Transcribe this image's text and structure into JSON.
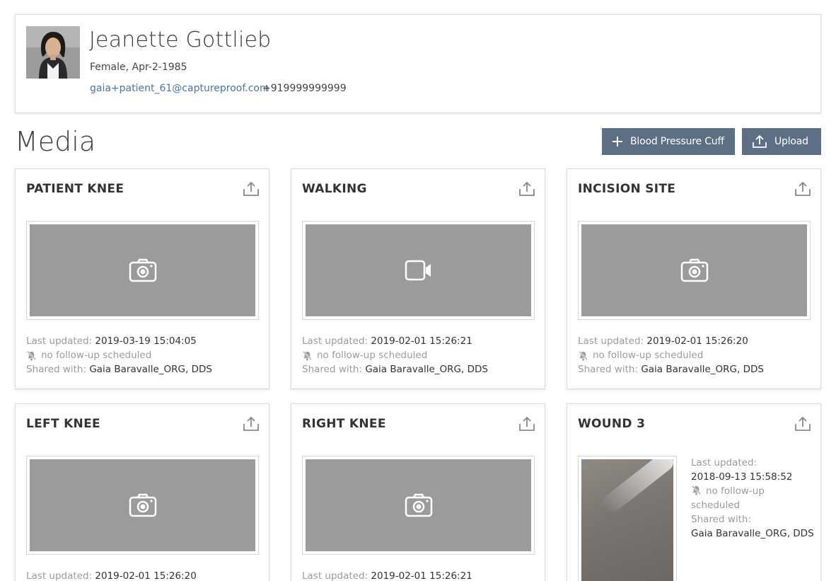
{
  "patient": {
    "name": "Jeanette Gottlieb",
    "demographics": "Female, Apr-2-1985",
    "email": "gaia+patient_61@captureproof.com",
    "phone": "+919999999999"
  },
  "media": {
    "title": "Media",
    "buttons": {
      "blood_pressure": "Blood Pressure Cuff",
      "upload": "Upload"
    },
    "labels": {
      "last_updated": "Last updated:",
      "no_followup": "no follow-up scheduled",
      "no_followup_line1": "no follow-up",
      "no_followup_line2": "scheduled",
      "shared_with": "Shared with:"
    },
    "cards": [
      {
        "title": "PATIENT KNEE",
        "type": "photo-placeholder",
        "last_updated": "2019-03-19 15:04:05",
        "shared_with": "Gaia Baravalle_ORG, DDS"
      },
      {
        "title": "WALKING",
        "type": "video-placeholder",
        "last_updated": "2019-02-01 15:26:21",
        "shared_with": "Gaia Baravalle_ORG, DDS"
      },
      {
        "title": "INCISION SITE",
        "type": "photo-placeholder",
        "last_updated": "2019-02-01 15:26:20",
        "shared_with": "Gaia Baravalle_ORG, DDS"
      },
      {
        "title": "LEFT KNEE",
        "type": "photo-placeholder",
        "last_updated": "2019-02-01 15:26:20"
      },
      {
        "title": "RIGHT KNEE",
        "type": "photo-placeholder",
        "last_updated": "2019-02-01 15:26:21"
      },
      {
        "title": "WOUND 3",
        "type": "photo",
        "last_updated": "2018-09-13 15:58:52",
        "shared_with": "Gaia Baravalle_ORG, DDS"
      }
    ]
  },
  "colors": {
    "button_bg": "#5d6f84",
    "link": "#4a74a5",
    "placeholder_bg": "#9b9b9b"
  }
}
